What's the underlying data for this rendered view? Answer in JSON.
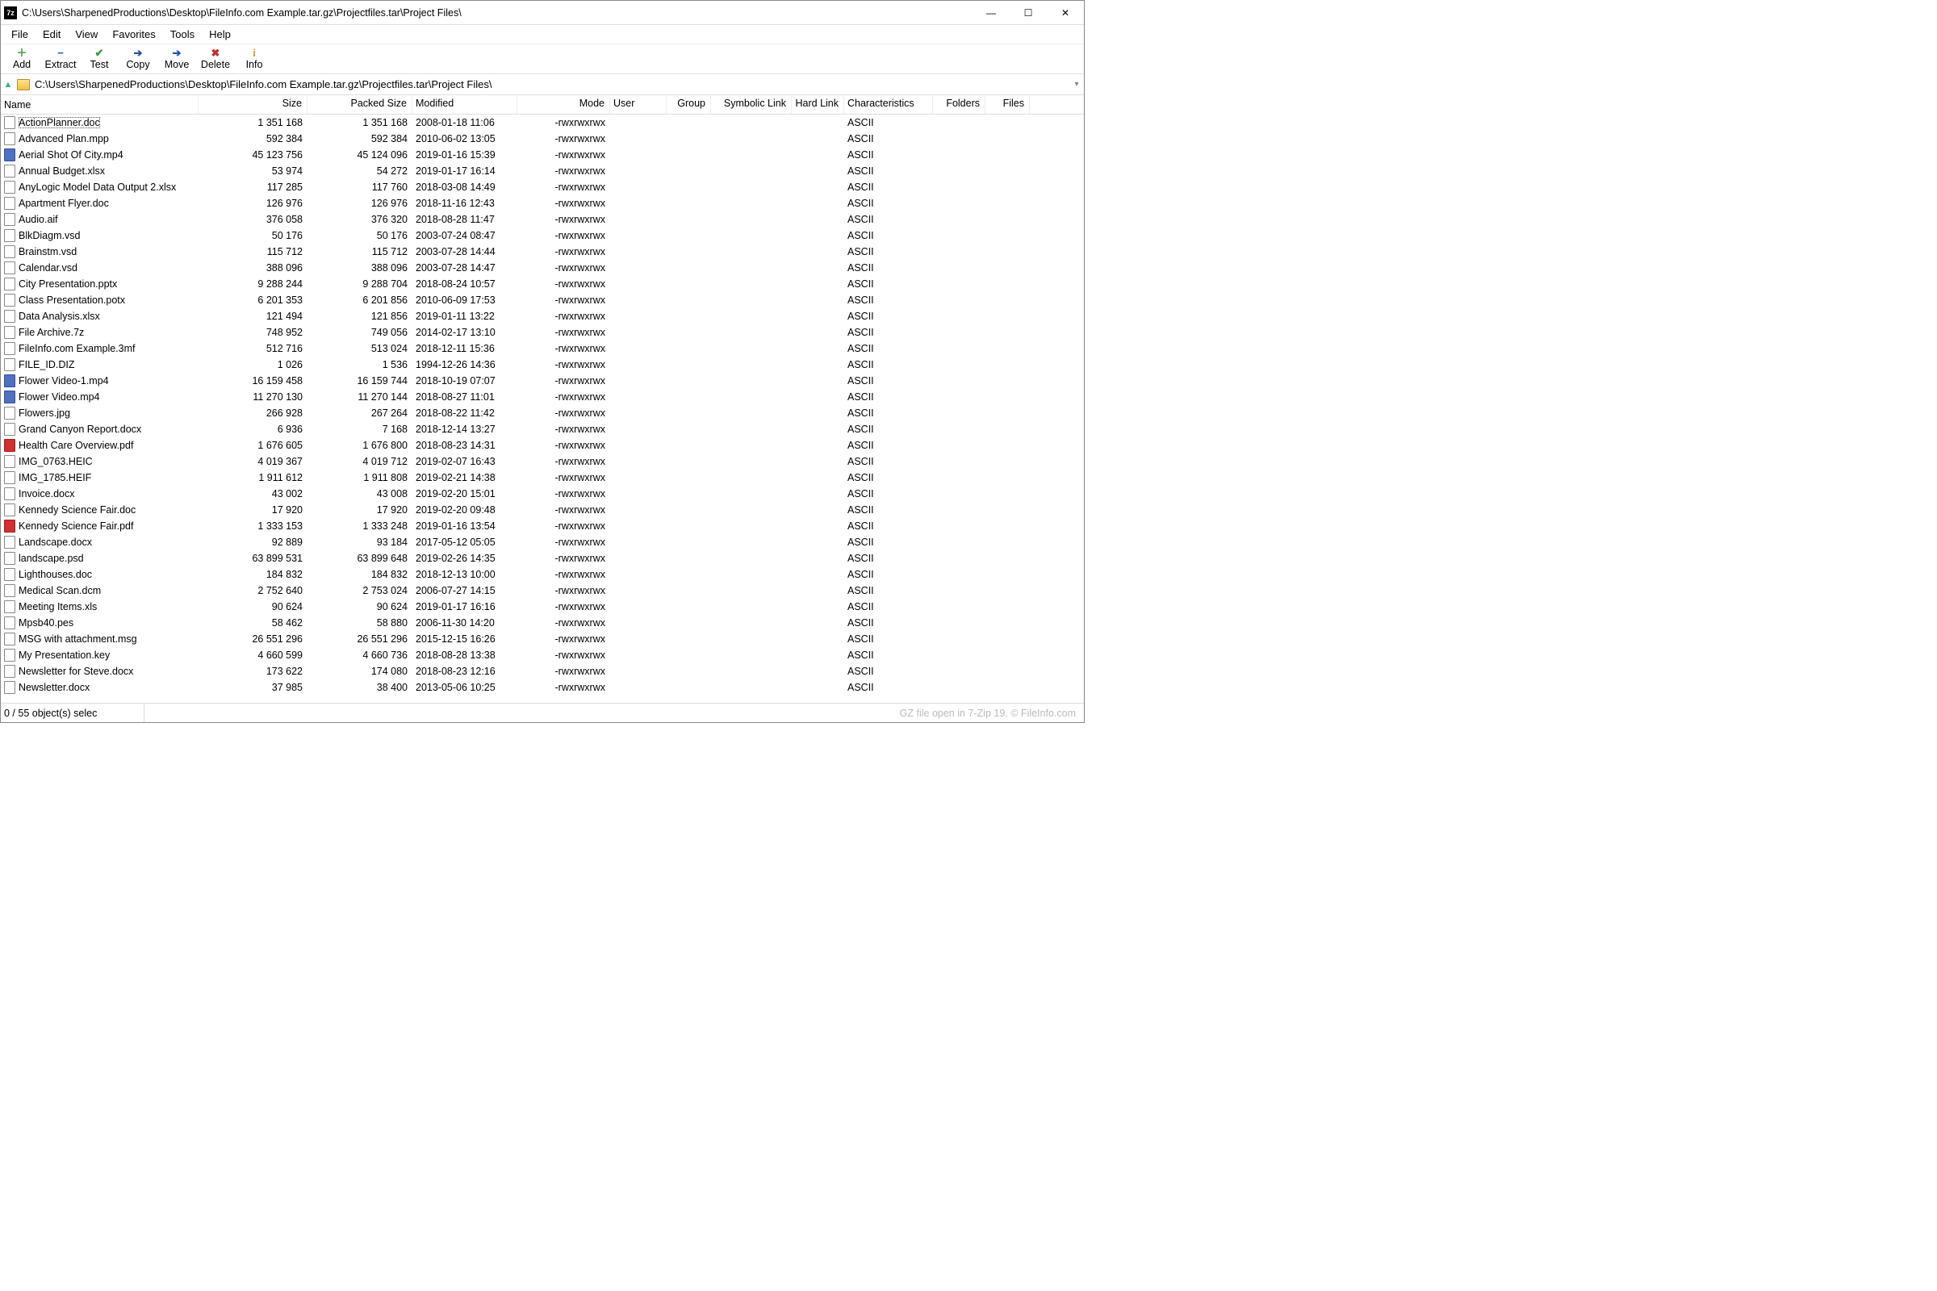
{
  "window": {
    "app_icon_text": "7z",
    "title": "C:\\Users\\SharpenedProductions\\Desktop\\FileInfo.com Example.tar.gz\\Projectfiles.tar\\Project Files\\"
  },
  "window_controls": {
    "min": "—",
    "max": "☐",
    "close": "✕"
  },
  "menubar": [
    "File",
    "Edit",
    "View",
    "Favorites",
    "Tools",
    "Help"
  ],
  "toolbar": [
    {
      "label": "Add",
      "icon": "＋",
      "color": "#3a9a3a"
    },
    {
      "label": "Extract",
      "icon": "−",
      "color": "#2050b0"
    },
    {
      "label": "Test",
      "icon": "✔",
      "color": "#3a9a3a"
    },
    {
      "label": "Copy",
      "icon": "➔",
      "color": "#2050b0"
    },
    {
      "label": "Move",
      "icon": "➔",
      "color": "#2050b0"
    },
    {
      "label": "Delete",
      "icon": "✖",
      "color": "#c03030"
    },
    {
      "label": "Info",
      "icon": "i",
      "color": "#c9a227"
    }
  ],
  "addressbar": {
    "path": "C:\\Users\\SharpenedProductions\\Desktop\\FileInfo.com Example.tar.gz\\Projectfiles.tar\\Project Files\\"
  },
  "columns": [
    "Name",
    "Size",
    "Packed Size",
    "Modified",
    "Mode",
    "User",
    "Group",
    "Symbolic Link",
    "Hard Link",
    "Characteristics",
    "Folders",
    "Files"
  ],
  "rows": [
    {
      "name": "ActionPlanner.doc",
      "size": "1 351 168",
      "psize": "1 351 168",
      "mod": "2008-01-18 11:06",
      "mode": "-rwxrwxrwx",
      "char": "ASCII",
      "icon": "doc",
      "focus": true
    },
    {
      "name": "Advanced Plan.mpp",
      "size": "592 384",
      "psize": "592 384",
      "mod": "2010-06-02 13:05",
      "mode": "-rwxrwxrwx",
      "char": "ASCII",
      "icon": "doc"
    },
    {
      "name": "Aerial Shot Of City.mp4",
      "size": "45 123 756",
      "psize": "45 124 096",
      "mod": "2019-01-16 15:39",
      "mode": "-rwxrwxrwx",
      "char": "ASCII",
      "icon": "vid"
    },
    {
      "name": "Annual Budget.xlsx",
      "size": "53 974",
      "psize": "54 272",
      "mod": "2019-01-17 16:14",
      "mode": "-rwxrwxrwx",
      "char": "ASCII",
      "icon": "doc"
    },
    {
      "name": "AnyLogic Model Data Output 2.xlsx",
      "size": "117 285",
      "psize": "117 760",
      "mod": "2018-03-08 14:49",
      "mode": "-rwxrwxrwx",
      "char": "ASCII",
      "icon": "doc"
    },
    {
      "name": "Apartment Flyer.doc",
      "size": "126 976",
      "psize": "126 976",
      "mod": "2018-11-16 12:43",
      "mode": "-rwxrwxrwx",
      "char": "ASCII",
      "icon": "doc"
    },
    {
      "name": "Audio.aif",
      "size": "376 058",
      "psize": "376 320",
      "mod": "2018-08-28 11:47",
      "mode": "-rwxrwxrwx",
      "char": "ASCII",
      "icon": "doc"
    },
    {
      "name": "BlkDiagm.vsd",
      "size": "50 176",
      "psize": "50 176",
      "mod": "2003-07-24 08:47",
      "mode": "-rwxrwxrwx",
      "char": "ASCII",
      "icon": "doc"
    },
    {
      "name": "Brainstm.vsd",
      "size": "115 712",
      "psize": "115 712",
      "mod": "2003-07-28 14:44",
      "mode": "-rwxrwxrwx",
      "char": "ASCII",
      "icon": "doc"
    },
    {
      "name": "Calendar.vsd",
      "size": "388 096",
      "psize": "388 096",
      "mod": "2003-07-28 14:47",
      "mode": "-rwxrwxrwx",
      "char": "ASCII",
      "icon": "doc"
    },
    {
      "name": "City Presentation.pptx",
      "size": "9 288 244",
      "psize": "9 288 704",
      "mod": "2018-08-24 10:57",
      "mode": "-rwxrwxrwx",
      "char": "ASCII",
      "icon": "doc"
    },
    {
      "name": "Class Presentation.potx",
      "size": "6 201 353",
      "psize": "6 201 856",
      "mod": "2010-06-09 17:53",
      "mode": "-rwxrwxrwx",
      "char": "ASCII",
      "icon": "doc"
    },
    {
      "name": "Data Analysis.xlsx",
      "size": "121 494",
      "psize": "121 856",
      "mod": "2019-01-11 13:22",
      "mode": "-rwxrwxrwx",
      "char": "ASCII",
      "icon": "doc"
    },
    {
      "name": "File Archive.7z",
      "size": "748 952",
      "psize": "749 056",
      "mod": "2014-02-17 13:10",
      "mode": "-rwxrwxrwx",
      "char": "ASCII",
      "icon": "doc"
    },
    {
      "name": "FileInfo.com Example.3mf",
      "size": "512 716",
      "psize": "513 024",
      "mod": "2018-12-11 15:36",
      "mode": "-rwxrwxrwx",
      "char": "ASCII",
      "icon": "doc"
    },
    {
      "name": "FILE_ID.DIZ",
      "size": "1 026",
      "psize": "1 536",
      "mod": "1994-12-26 14:36",
      "mode": "-rwxrwxrwx",
      "char": "ASCII",
      "icon": "doc"
    },
    {
      "name": "Flower Video-1.mp4",
      "size": "16 159 458",
      "psize": "16 159 744",
      "mod": "2018-10-19 07:07",
      "mode": "-rwxrwxrwx",
      "char": "ASCII",
      "icon": "vid"
    },
    {
      "name": "Flower Video.mp4",
      "size": "11 270 130",
      "psize": "11 270 144",
      "mod": "2018-08-27 11:01",
      "mode": "-rwxrwxrwx",
      "char": "ASCII",
      "icon": "vid"
    },
    {
      "name": "Flowers.jpg",
      "size": "266 928",
      "psize": "267 264",
      "mod": "2018-08-22 11:42",
      "mode": "-rwxrwxrwx",
      "char": "ASCII",
      "icon": "doc"
    },
    {
      "name": "Grand Canyon Report.docx",
      "size": "6 936",
      "psize": "7 168",
      "mod": "2018-12-14 13:27",
      "mode": "-rwxrwxrwx",
      "char": "ASCII",
      "icon": "doc"
    },
    {
      "name": "Health Care Overview.pdf",
      "size": "1 676 605",
      "psize": "1 676 800",
      "mod": "2018-08-23 14:31",
      "mode": "-rwxrwxrwx",
      "char": "ASCII",
      "icon": "pdf"
    },
    {
      "name": "IMG_0763.HEIC",
      "size": "4 019 367",
      "psize": "4 019 712",
      "mod": "2019-02-07 16:43",
      "mode": "-rwxrwxrwx",
      "char": "ASCII",
      "icon": "doc"
    },
    {
      "name": "IMG_1785.HEIF",
      "size": "1 911 612",
      "psize": "1 911 808",
      "mod": "2019-02-21 14:38",
      "mode": "-rwxrwxrwx",
      "char": "ASCII",
      "icon": "doc"
    },
    {
      "name": "Invoice.docx",
      "size": "43 002",
      "psize": "43 008",
      "mod": "2019-02-20 15:01",
      "mode": "-rwxrwxrwx",
      "char": "ASCII",
      "icon": "doc"
    },
    {
      "name": "Kennedy Science Fair.doc",
      "size": "17 920",
      "psize": "17 920",
      "mod": "2019-02-20 09:48",
      "mode": "-rwxrwxrwx",
      "char": "ASCII",
      "icon": "doc"
    },
    {
      "name": "Kennedy Science Fair.pdf",
      "size": "1 333 153",
      "psize": "1 333 248",
      "mod": "2019-01-16 13:54",
      "mode": "-rwxrwxrwx",
      "char": "ASCII",
      "icon": "pdf"
    },
    {
      "name": "Landscape.docx",
      "size": "92 889",
      "psize": "93 184",
      "mod": "2017-05-12 05:05",
      "mode": "-rwxrwxrwx",
      "char": "ASCII",
      "icon": "doc"
    },
    {
      "name": "landscape.psd",
      "size": "63 899 531",
      "psize": "63 899 648",
      "mod": "2019-02-26 14:35",
      "mode": "-rwxrwxrwx",
      "char": "ASCII",
      "icon": "doc"
    },
    {
      "name": "Lighthouses.doc",
      "size": "184 832",
      "psize": "184 832",
      "mod": "2018-12-13 10:00",
      "mode": "-rwxrwxrwx",
      "char": "ASCII",
      "icon": "doc"
    },
    {
      "name": "Medical Scan.dcm",
      "size": "2 752 640",
      "psize": "2 753 024",
      "mod": "2006-07-27 14:15",
      "mode": "-rwxrwxrwx",
      "char": "ASCII",
      "icon": "doc"
    },
    {
      "name": "Meeting Items.xls",
      "size": "90 624",
      "psize": "90 624",
      "mod": "2019-01-17 16:16",
      "mode": "-rwxrwxrwx",
      "char": "ASCII",
      "icon": "doc"
    },
    {
      "name": "Mpsb40.pes",
      "size": "58 462",
      "psize": "58 880",
      "mod": "2006-11-30 14:20",
      "mode": "-rwxrwxrwx",
      "char": "ASCII",
      "icon": "doc"
    },
    {
      "name": "MSG with attachment.msg",
      "size": "26 551 296",
      "psize": "26 551 296",
      "mod": "2015-12-15 16:26",
      "mode": "-rwxrwxrwx",
      "char": "ASCII",
      "icon": "doc"
    },
    {
      "name": "My Presentation.key",
      "size": "4 660 599",
      "psize": "4 660 736",
      "mod": "2018-08-28 13:38",
      "mode": "-rwxrwxrwx",
      "char": "ASCII",
      "icon": "doc"
    },
    {
      "name": "Newsletter for Steve.docx",
      "size": "173 622",
      "psize": "174 080",
      "mod": "2018-08-23 12:16",
      "mode": "-rwxrwxrwx",
      "char": "ASCII",
      "icon": "doc"
    },
    {
      "name": "Newsletter.docx",
      "size": "37 985",
      "psize": "38 400",
      "mod": "2013-05-06 10:25",
      "mode": "-rwxrwxrwx",
      "char": "ASCII",
      "icon": "doc"
    }
  ],
  "statusbar": {
    "left": "0 / 55 object(s) selec",
    "right": "GZ file open in 7-Zip 19. © FileInfo.com"
  }
}
